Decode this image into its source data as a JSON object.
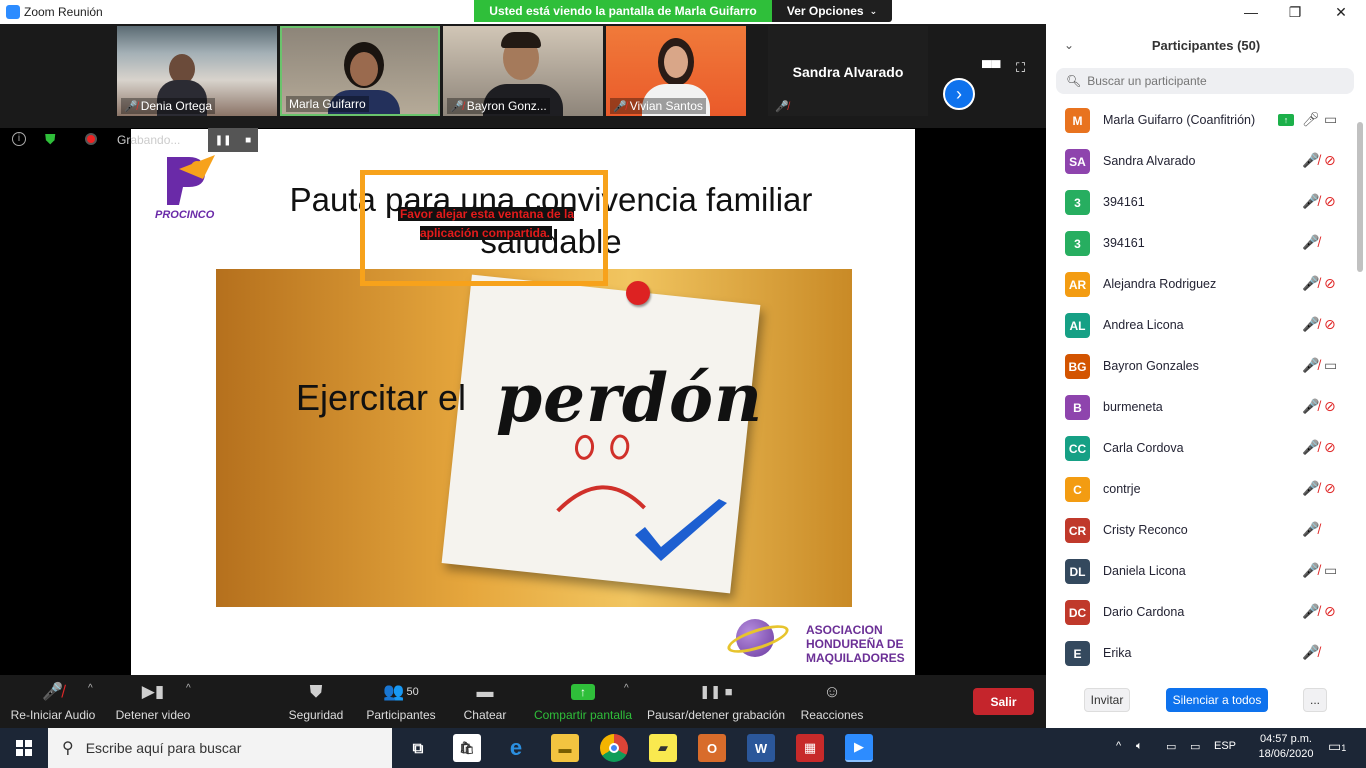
{
  "window": {
    "title": "Zoom Reunión"
  },
  "banner": {
    "sharing_text": "Usted está viendo la pantalla de  Marla Guifarro",
    "view_options": "Ver Opciones"
  },
  "gallery": {
    "tiles": [
      {
        "name": "Denia Ortega",
        "muted": true
      },
      {
        "name": "Marla Guifarro",
        "muted": false,
        "active": true
      },
      {
        "name": "Bayron Gonz...",
        "muted": true
      },
      {
        "name": "Vivian Santos",
        "muted": true
      },
      {
        "name": "Sandra Alvarado",
        "muted": true
      }
    ]
  },
  "recording": {
    "status": "Grabando..."
  },
  "slide": {
    "title": "Pauta para una convivencia familiar saludable",
    "warning": "Favor alejar esta ventana de la aplicación compartida.",
    "main_word": "perdón",
    "caption": "Ejercitar el",
    "logo_left": "PROCINCO",
    "logo_right_l1": "ASOCIACION",
    "logo_right_l2": "HONDUREÑA DE",
    "logo_right_l3": "MAQUILADORES"
  },
  "toolbar": {
    "audio": "Re-Iniciar Audio",
    "video": "Detener video",
    "security": "Seguridad",
    "participants": "Participantes",
    "participants_count": "50",
    "chat": "Chatear",
    "share": "Compartir pantalla",
    "record": "Pausar/detener grabación",
    "reactions": "Reacciones",
    "leave": "Salir"
  },
  "panel": {
    "title": "Participantes (50)",
    "search_placeholder": "Buscar un participante",
    "participants": [
      {
        "initials": "M",
        "name": "Marla Guifarro (Coanfitrión)",
        "color": "#e8731f",
        "mic": "on",
        "cam": "on",
        "sharing": true
      },
      {
        "initials": "SA",
        "name": "Sandra Alvarado",
        "color": "#8e44ad",
        "mic": "off",
        "cam": "off"
      },
      {
        "initials": "3",
        "name": "394161",
        "color": "#27ae60",
        "mic": "off",
        "cam": "off"
      },
      {
        "initials": "3",
        "name": "394161",
        "color": "#27ae60",
        "mic": "off",
        "cam": "none"
      },
      {
        "initials": "AR",
        "name": "Alejandra Rodriguez",
        "color": "#f39c12",
        "mic": "off",
        "cam": "off"
      },
      {
        "initials": "AL",
        "name": "Andrea Licona",
        "color": "#16a085",
        "mic": "off",
        "cam": "off"
      },
      {
        "initials": "BG",
        "name": "Bayron Gonzales",
        "color": "#d35400",
        "mic": "off",
        "cam": "on"
      },
      {
        "initials": "B",
        "name": "burmeneta",
        "color": "#8e44ad",
        "mic": "off",
        "cam": "off"
      },
      {
        "initials": "CC",
        "name": "Carla Cordova",
        "color": "#16a085",
        "mic": "off",
        "cam": "off"
      },
      {
        "initials": "C",
        "name": "contrje",
        "color": "#f39c12",
        "mic": "off",
        "cam": "off"
      },
      {
        "initials": "CR",
        "name": "Cristy Reconco",
        "color": "#c0392b",
        "mic": "off",
        "cam": "none"
      },
      {
        "initials": "DL",
        "name": "Daniela  Licona",
        "color": "#34495e",
        "mic": "off",
        "cam": "on"
      },
      {
        "initials": "DC",
        "name": "Dario Cardona",
        "color": "#c0392b",
        "mic": "off",
        "cam": "off"
      },
      {
        "initials": "E",
        "name": "Erika",
        "color": "#34495e",
        "mic": "off",
        "cam": "none"
      }
    ],
    "invite": "Invitar",
    "mute_all": "Silenciar a todos",
    "more": "..."
  },
  "taskbar": {
    "search_placeholder": "Escribe aquí para buscar",
    "lang": "ESP",
    "time": "04:57 p.m.",
    "date": "18/06/2020",
    "notifications": "1"
  }
}
